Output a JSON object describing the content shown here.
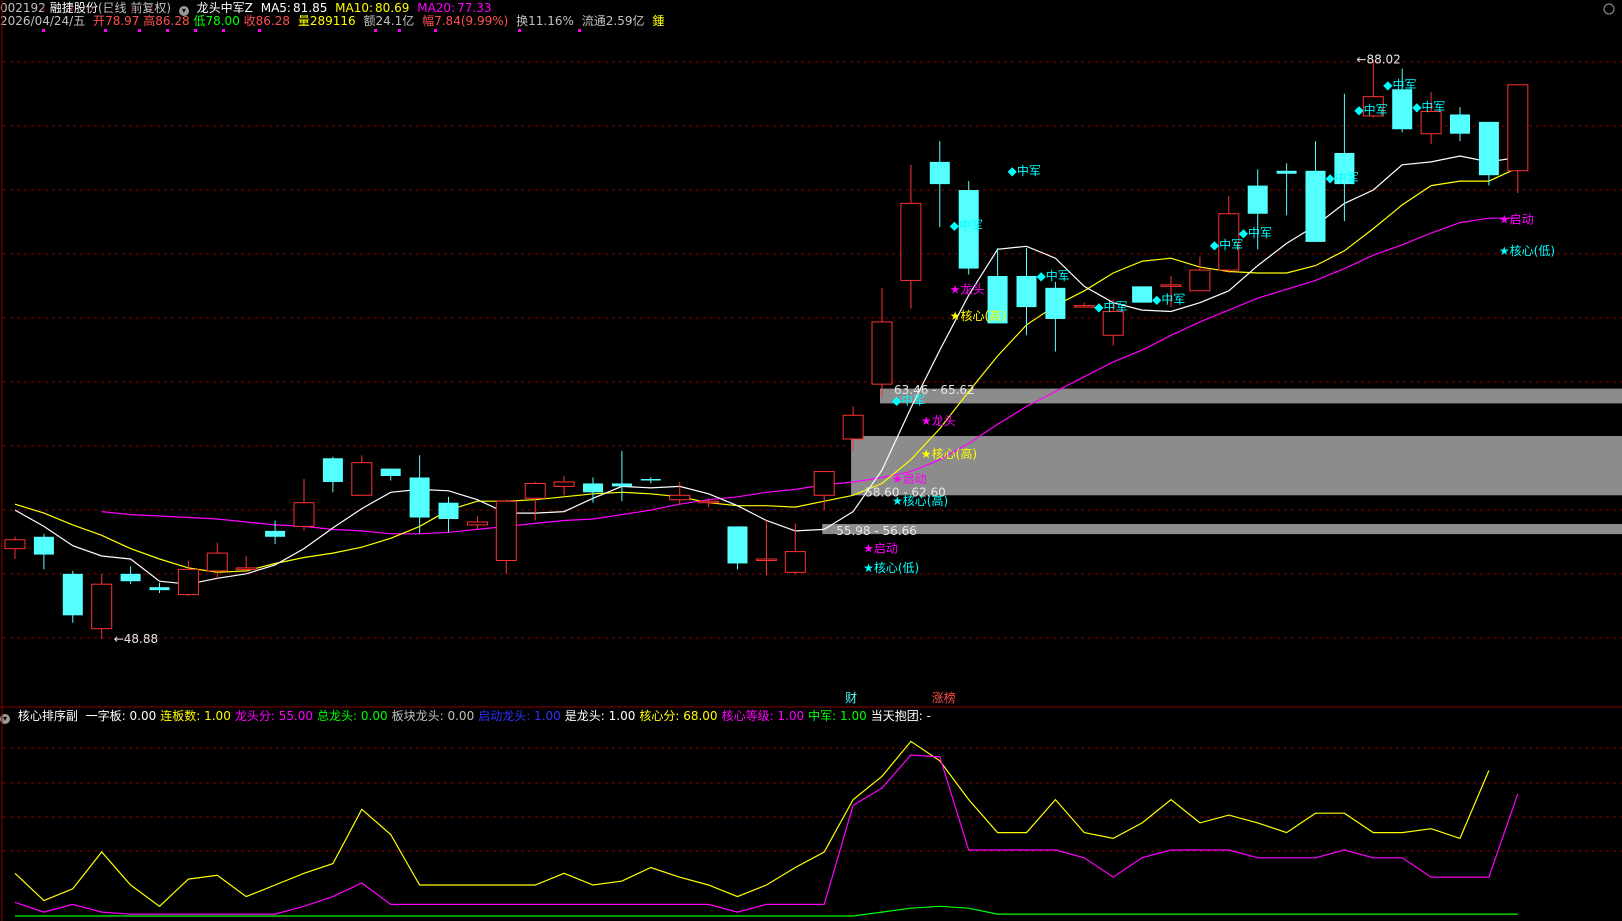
{
  "header": {
    "code": "002192",
    "name": "融捷股份",
    "mode": "(日线 前复权)",
    "indicator": "龙头中军Z",
    "ma5": {
      "label": "MA5:",
      "value": "81.85",
      "color": "#ffffff"
    },
    "ma10": {
      "label": "MA10:",
      "value": "80.69",
      "color": "#ffff00"
    },
    "ma20": {
      "label": "MA20:",
      "value": "77.33",
      "color": "#ff00ff"
    }
  },
  "quote": {
    "date": "2026/04/24/五",
    "open_label": "开",
    "open": "78.97",
    "high_label": "高",
    "high": "86.28",
    "low_label": "低",
    "low": "78.00",
    "close_label": "收",
    "close": "86.28",
    "volume_label": "量",
    "volume": "289116",
    "amount_label": "额",
    "amount": "24.1亿",
    "change_label": "幅",
    "change": "7.84(9.99%)",
    "turnover_label": "换",
    "turnover": "11.16%",
    "float_label": "流通",
    "float": "2.59亿",
    "badge": "鍾"
  },
  "sub_header": {
    "name": "核心排序副",
    "fields": [
      {
        "label": "一字板:",
        "value": "0.00",
        "color": "#ffffff"
      },
      {
        "label": "连板数:",
        "value": "1.00",
        "color": "#ffff00"
      },
      {
        "label": "龙头分:",
        "value": "55.00",
        "color": "#ff00ff"
      },
      {
        "label": "总龙头:",
        "value": "0.00",
        "color": "#00ff00"
      },
      {
        "label": "板块龙头:",
        "value": "0.00",
        "color": "#c0c0c0"
      },
      {
        "label": "启动龙头:",
        "value": "1.00",
        "color": "#3030ff"
      },
      {
        "label": "是龙头:",
        "value": "1.00",
        "color": "#ffffff"
      },
      {
        "label": "核心分:",
        "value": "68.00",
        "color": "#ffff00"
      },
      {
        "label": "核心等级:",
        "value": "1.00",
        "color": "#ff00ff"
      },
      {
        "label": "中军:",
        "value": "1.00",
        "color": "#00ff00"
      },
      {
        "label": "当天抱团:",
        "value": "-",
        "color": "#ffffff"
      }
    ]
  },
  "colors": {
    "up": "#ff3232",
    "down": "#54ffff",
    "ma5": "#ffffff",
    "ma10": "#ffff00",
    "ma20": "#ff00ff",
    "grid": "#8b0000",
    "zone": "#8c8c8c",
    "signal_cyan": "#00ffff",
    "signal_magenta": "#ff00ff",
    "signal_yellow": "#ffff00"
  },
  "chart_data": [
    {
      "type": "candlestick",
      "title": "",
      "ylim": [
        46,
        90
      ],
      "candles": [
        {
          "o": 55.0,
          "h": 55.8,
          "l": 54.3,
          "c": 55.6
        },
        {
          "o": 55.8,
          "h": 56.0,
          "l": 53.6,
          "c": 54.6
        },
        {
          "o": 53.3,
          "h": 53.5,
          "l": 50.0,
          "c": 50.5
        },
        {
          "o": 49.6,
          "h": 53.3,
          "l": 48.9,
          "c": 52.6
        },
        {
          "o": 53.3,
          "h": 53.8,
          "l": 52.6,
          "c": 52.8
        },
        {
          "o": 52.4,
          "h": 52.7,
          "l": 52.0,
          "c": 52.2
        },
        {
          "o": 51.9,
          "h": 54.2,
          "l": 51.8,
          "c": 53.6
        },
        {
          "o": 53.5,
          "h": 55.4,
          "l": 53.0,
          "c": 54.7
        },
        {
          "o": 53.6,
          "h": 54.5,
          "l": 53.4,
          "c": 53.7
        },
        {
          "o": 56.2,
          "h": 56.9,
          "l": 55.3,
          "c": 55.8
        },
        {
          "o": 56.5,
          "h": 59.7,
          "l": 56.2,
          "c": 58.1
        },
        {
          "o": 61.1,
          "h": 61.2,
          "l": 58.8,
          "c": 59.5
        },
        {
          "o": 58.6,
          "h": 61.3,
          "l": 58.6,
          "c": 60.8
        },
        {
          "o": 60.4,
          "h": 60.4,
          "l": 59.6,
          "c": 59.9
        },
        {
          "o": 59.8,
          "h": 61.3,
          "l": 56.0,
          "c": 57.1
        },
        {
          "o": 58.1,
          "h": 58.5,
          "l": 56.1,
          "c": 57.0
        },
        {
          "o": 56.6,
          "h": 57.2,
          "l": 56.3,
          "c": 56.8
        },
        {
          "o": 54.2,
          "h": 58.3,
          "l": 53.3,
          "c": 58.2
        },
        {
          "o": 58.4,
          "h": 59.5,
          "l": 56.9,
          "c": 59.4
        },
        {
          "o": 59.2,
          "h": 59.9,
          "l": 58.6,
          "c": 59.5
        },
        {
          "o": 59.4,
          "h": 59.8,
          "l": 58.1,
          "c": 58.8
        },
        {
          "o": 59.4,
          "h": 61.6,
          "l": 58.2,
          "c": 59.2
        },
        {
          "o": 59.7,
          "h": 59.8,
          "l": 59.4,
          "c": 59.6
        },
        {
          "o": 58.3,
          "h": 59.5,
          "l": 58.0,
          "c": 58.6
        },
        {
          "o": 58.1,
          "h": 58.4,
          "l": 57.8,
          "c": 58.2
        },
        {
          "o": 56.5,
          "h": 56.5,
          "l": 53.6,
          "c": 54.0
        },
        {
          "o": 54.2,
          "h": 56.9,
          "l": 53.2,
          "c": 54.3
        },
        {
          "o": 53.4,
          "h": 56.7,
          "l": 53.3,
          "c": 54.8
        },
        {
          "o": 58.6,
          "h": 59.6,
          "l": 57.6,
          "c": 60.2
        },
        {
          "o": 62.4,
          "h": 64.6,
          "l": 61.6,
          "c": 64.0
        },
        {
          "o": 66.1,
          "h": 72.6,
          "l": 65.2,
          "c": 70.3
        },
        {
          "o": 73.1,
          "h": 80.9,
          "l": 71.2,
          "c": 78.3
        },
        {
          "o": 81.1,
          "h": 82.5,
          "l": 76.7,
          "c": 79.6
        },
        {
          "o": 79.2,
          "h": 79.8,
          "l": 73.5,
          "c": 73.9
        },
        {
          "o": 73.4,
          "h": 75.3,
          "l": 70.2,
          "c": 70.2
        },
        {
          "o": 73.4,
          "h": 75.3,
          "l": 69.4,
          "c": 71.3
        },
        {
          "o": 72.6,
          "h": 73.0,
          "l": 68.3,
          "c": 70.5
        },
        {
          "o": 71.4,
          "h": 71.6,
          "l": 71.3,
          "c": 71.4
        },
        {
          "o": 69.4,
          "h": 71.8,
          "l": 68.7,
          "c": 71.0
        },
        {
          "o": 72.7,
          "h": 72.7,
          "l": 71.6,
          "c": 71.6
        },
        {
          "o": 72.7,
          "h": 73.4,
          "l": 71.3,
          "c": 72.8
        },
        {
          "o": 72.4,
          "h": 74.7,
          "l": 72.4,
          "c": 73.8
        },
        {
          "o": 73.8,
          "h": 78.8,
          "l": 73.6,
          "c": 77.6
        },
        {
          "o": 79.5,
          "h": 80.6,
          "l": 75.2,
          "c": 77.6
        },
        {
          "o": 80.5,
          "h": 81.0,
          "l": 77.5,
          "c": 80.3
        },
        {
          "o": 80.5,
          "h": 82.5,
          "l": 80.5,
          "c": 75.7
        },
        {
          "o": 81.7,
          "h": 85.7,
          "l": 77.1,
          "c": 79.6
        },
        {
          "o": 84.2,
          "h": 88.0,
          "l": 84.1,
          "c": 85.5
        },
        {
          "o": 86.0,
          "h": 87.4,
          "l": 83.1,
          "c": 83.3
        },
        {
          "o": 83.0,
          "h": 85.8,
          "l": 82.3,
          "c": 84.5
        },
        {
          "o": 84.3,
          "h": 84.8,
          "l": 82.5,
          "c": 83.0
        },
        {
          "o": 83.8,
          "h": 83.8,
          "l": 79.5,
          "c": 80.2
        },
        {
          "o": 80.5,
          "h": 86.3,
          "l": 79.0,
          "c": 86.3
        }
      ],
      "ma5": [
        57.6,
        56.5,
        55.2,
        54.5,
        54.3,
        52.8,
        52.6,
        53.0,
        53.3,
        53.9,
        55.0,
        56.4,
        57.7,
        58.8,
        59.0,
        58.9,
        58.3,
        57.4,
        57.4,
        57.5,
        58.4,
        59.2,
        59.1,
        59.2,
        58.7,
        57.9,
        56.9,
        56.2,
        56.3,
        57.5,
        60.3,
        64.5,
        68.4,
        72.1,
        75.2,
        75.4,
        74.6,
        72.7,
        71.6,
        71.1,
        71.0,
        71.6,
        72.4,
        74.1,
        75.6,
        76.8,
        78.3,
        79.2,
        80.9,
        81.1,
        81.5,
        81.1,
        81.4
      ],
      "ma10": [
        58.0,
        57.4,
        56.6,
        55.9,
        55.0,
        54.3,
        53.7,
        53.4,
        53.5,
        54.0,
        54.4,
        54.7,
        55.1,
        55.7,
        56.5,
        57.6,
        58.2,
        58.2,
        58.3,
        58.5,
        58.7,
        58.8,
        58.7,
        58.5,
        58.1,
        57.9,
        57.9,
        57.8,
        58.2,
        58.6,
        59.4,
        61.0,
        63.1,
        65.6,
        68.0,
        70.1,
        71.4,
        72.4,
        73.6,
        74.4,
        74.6,
        74.0,
        73.7,
        73.6,
        73.6,
        74.1,
        75.1,
        76.6,
        78.2,
        79.5,
        79.8,
        79.8,
        80.7
      ],
      "ma20": [
        57.5,
        57.3,
        57.2,
        57.1,
        57.0,
        56.8,
        56.6,
        56.5,
        56.3,
        56.2,
        56.0,
        56.0,
        56.1,
        56.3,
        56.5,
        56.7,
        56.9,
        57.0,
        57.3,
        57.6,
        58.0,
        58.3,
        58.5,
        58.8,
        59.0,
        59.3,
        59.5,
        59.8,
        60.2,
        61.0,
        62.1,
        63.4,
        64.6,
        65.6,
        66.6,
        67.6,
        68.4,
        69.4,
        70.3,
        71.1,
        71.9,
        72.5,
        73.1,
        73.9,
        74.8,
        75.5,
        76.3,
        77.0,
        77.3,
        77.3
      ],
      "price_labels": [
        {
          "text": "←48.88",
          "i": 3,
          "v": 48.9
        },
        {
          "text": "←88.02",
          "i": 46,
          "v": 88.0
        },
        {
          "text": "55.98 - 56.66",
          "i": 28,
          "v": 56.2
        },
        {
          "text": "58.60 - 62.60",
          "i": 29,
          "v": 58.8
        },
        {
          "text": "63.46 - 65.62",
          "i": 30,
          "v": 65.7
        }
      ],
      "zones": [
        {
          "from": 55.98,
          "to": 56.66,
          "start": 28
        },
        {
          "from": 58.6,
          "to": 62.6,
          "start": 29
        },
        {
          "from": 64.8,
          "to": 65.8,
          "start": 30
        }
      ],
      "signals": [
        {
          "text": "★启动",
          "i": 29,
          "v": 55.0,
          "color": "#ff00ff"
        },
        {
          "text": "★核心(低)",
          "i": 29,
          "v": 53.7,
          "color": "#00ffff"
        },
        {
          "text": "★启动",
          "i": 30,
          "v": 59.7,
          "color": "#ff00ff"
        },
        {
          "text": "★核心(高)",
          "i": 30,
          "v": 58.2,
          "color": "#00ffff"
        },
        {
          "text": "★核心(高)",
          "i": 31,
          "v": 61.4,
          "color": "#ffff00"
        },
        {
          "text": "★龙头",
          "i": 31,
          "v": 63.6,
          "color": "#ff00ff"
        },
        {
          "text": "◆中军",
          "i": 30,
          "v": 65.0,
          "color": "#00ffff"
        },
        {
          "text": "★核心(高)",
          "i": 32,
          "v": 70.7,
          "color": "#ffff00"
        },
        {
          "text": "★龙头",
          "i": 32,
          "v": 72.5,
          "color": "#ff00ff"
        },
        {
          "text": "◆中军",
          "i": 32,
          "v": 76.8,
          "color": "#00ffff"
        },
        {
          "text": "◆中军",
          "i": 34,
          "v": 80.5,
          "color": "#00ffff"
        },
        {
          "text": "◆中军",
          "i": 35,
          "v": 73.4,
          "color": "#00ffff"
        },
        {
          "text": "◆中军",
          "i": 37,
          "v": 71.3,
          "color": "#00ffff"
        },
        {
          "text": "◆中军",
          "i": 39,
          "v": 71.8,
          "color": "#00ffff"
        },
        {
          "text": "◆中军",
          "i": 41,
          "v": 75.5,
          "color": "#00ffff"
        },
        {
          "text": "◆中军",
          "i": 42,
          "v": 76.3,
          "color": "#00ffff"
        },
        {
          "text": "◆中军",
          "i": 45,
          "v": 80.0,
          "color": "#00ffff"
        },
        {
          "text": "◆中军",
          "i": 46,
          "v": 84.6,
          "color": "#00ffff"
        },
        {
          "text": "◆中军",
          "i": 47,
          "v": 86.3,
          "color": "#00ffff"
        },
        {
          "text": "◆中军",
          "i": 48,
          "v": 84.8,
          "color": "#00ffff"
        },
        {
          "text": "★启动",
          "i": 51,
          "v": 77.2,
          "color": "#ff00ff"
        },
        {
          "text": "★核心(低)",
          "i": 51,
          "v": 75.1,
          "color": "#00ffff"
        }
      ],
      "event_markers": [
        {
          "text": "财",
          "i": 29,
          "color": "#54ffff"
        },
        {
          "text": "涨榜",
          "i": 32,
          "color": "#ff5050"
        }
      ]
    },
    {
      "type": "line",
      "title": "",
      "ylim": [
        0,
        100
      ],
      "series": [
        {
          "color": "#ffff00",
          "values": [
            22,
            8,
            14,
            33,
            16,
            5,
            19,
            21,
            10,
            16,
            22,
            27,
            55,
            42,
            16,
            16,
            16,
            16,
            16,
            22,
            16,
            18,
            25,
            20,
            16,
            10,
            16,
            25,
            33,
            60,
            72,
            90,
            80,
            60,
            43,
            43,
            60,
            43,
            40,
            48,
            60,
            48,
            52,
            48,
            43,
            53,
            53,
            43,
            43,
            45,
            40,
            75
          ]
        },
        {
          "color": "#ff00ff",
          "values": [
            7,
            2,
            6,
            2,
            1,
            1,
            1,
            1,
            1,
            1,
            5,
            10,
            17,
            6,
            6,
            6,
            6,
            6,
            6,
            6,
            6,
            6,
            6,
            6,
            6,
            2,
            6,
            6,
            6,
            57,
            66,
            83,
            82,
            34,
            34,
            34,
            34,
            30,
            20,
            30,
            34,
            34,
            34,
            30,
            30,
            30,
            34,
            30,
            30,
            20,
            20,
            20,
            63
          ]
        },
        {
          "color": "#00ff00",
          "values": [
            0,
            0,
            0,
            0,
            0,
            0,
            0,
            0,
            0,
            0,
            0,
            0,
            0,
            0,
            0,
            0,
            0,
            0,
            0,
            0,
            0,
            0,
            0,
            0,
            0,
            0,
            0,
            0,
            0,
            0,
            2,
            4,
            5,
            4,
            1,
            1,
            1,
            1,
            1,
            1,
            1,
            1,
            1,
            1,
            1,
            1,
            1,
            1,
            1,
            1,
            1,
            1,
            1
          ]
        }
      ]
    }
  ]
}
